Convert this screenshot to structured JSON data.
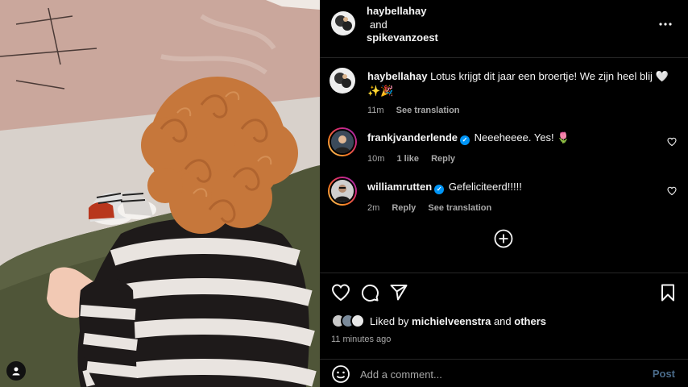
{
  "photo": {
    "description_icon": "user-tag-icon"
  },
  "header": {
    "user1": "haybellahay",
    "and": "and",
    "user2": "spikevanzoest",
    "more_icon": "more-horizontal-icon"
  },
  "caption": {
    "username": "haybellahay",
    "text": "Lotus krijgt dit jaar een broertje! We zijn heel blij",
    "emojis": "🤍✨🎉",
    "time": "11m",
    "see_translation": "See translation"
  },
  "comments": [
    {
      "username": "frankjvanderlende",
      "verified": true,
      "text": "Neeeheeee. Yes! 🌷",
      "time": "10m",
      "likes": "1 like",
      "reply": "Reply"
    },
    {
      "username": "williamrutten",
      "verified": true,
      "text": "Gefeliciteerd!!!!!",
      "time": "2m",
      "reply": "Reply",
      "see_translation": "See translation"
    }
  ],
  "actions": {
    "liked_by_prefix": "Liked by",
    "liked_by_user": "michielveenstra",
    "liked_by_and": "and",
    "liked_by_others": "others",
    "time_ago": "11 minutes ago"
  },
  "add_comment": {
    "placeholder": "Add a comment...",
    "post_label": "Post"
  },
  "colors": {
    "background": "#000000",
    "text": "#f5f5f5",
    "muted": "#a8a8a8",
    "verified": "#0095f6",
    "post_disabled": "#4a6b8a"
  }
}
